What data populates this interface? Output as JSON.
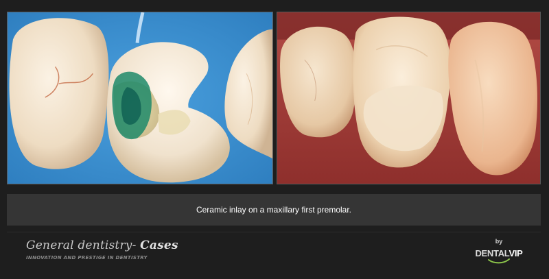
{
  "images": {
    "before": {
      "alt": ""
    },
    "after": {
      "alt": ""
    }
  },
  "caption": "Ceramic inlay on a maxillary first premolar.",
  "branding": {
    "title_main": "General dentistry- ",
    "title_accent": "Cases",
    "tagline": "INNOVATION AND PRESTIGE IN DENTISTRY"
  },
  "logo": {
    "by": "by",
    "name_main": "DENTAL",
    "name_accent": "VIP"
  },
  "colors": {
    "background": "#1e1e1e",
    "caption_bar": "#353535",
    "rubber_dam": "#3d8fd0",
    "swoosh": "#8bc34a"
  }
}
